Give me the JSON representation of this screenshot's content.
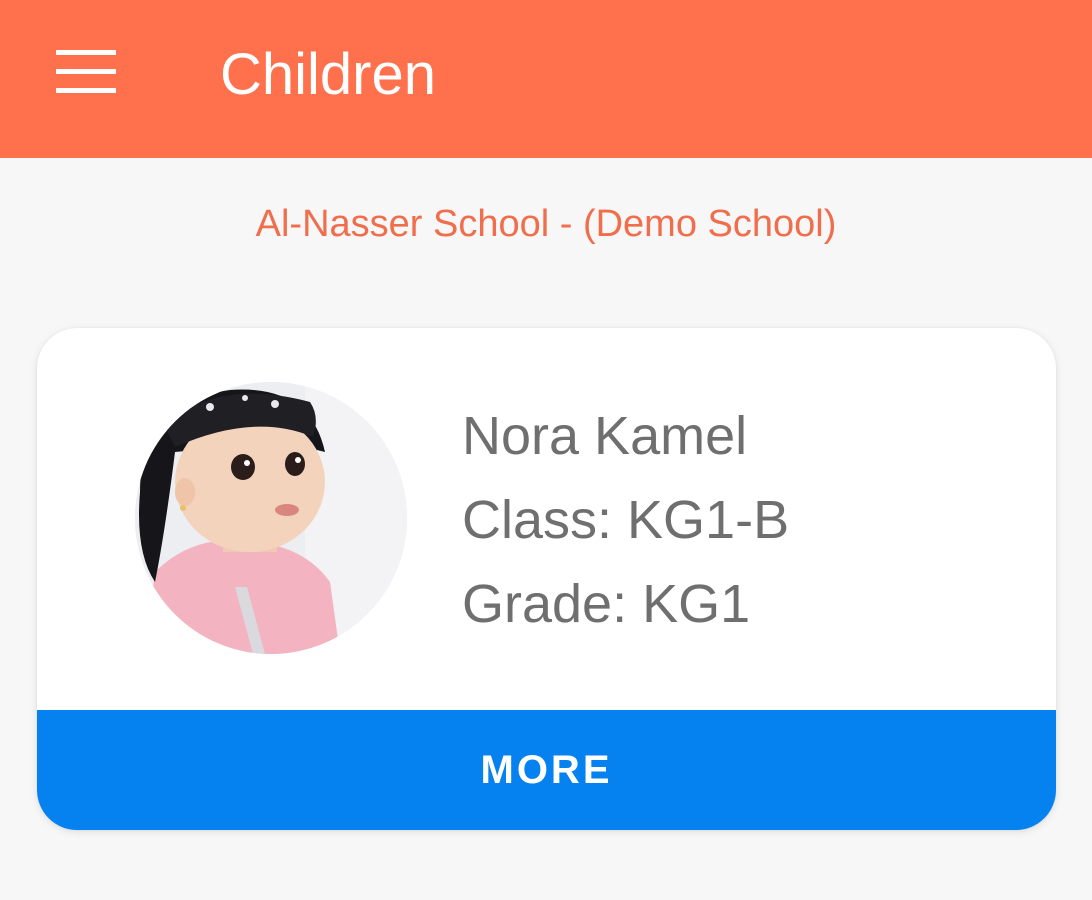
{
  "app_bar": {
    "title": "Children",
    "menu_icon": "hamburger-menu-icon",
    "background_color": "#ff704c"
  },
  "school": {
    "name": "Al-Nasser School - (Demo School)",
    "color": "#f06e4c"
  },
  "children": [
    {
      "name": "Nora Kamel",
      "class_text": "Class: KG1-B",
      "grade_text": "Grade: KG1",
      "more_label": "MORE",
      "more_color": "#0582f0"
    }
  ]
}
